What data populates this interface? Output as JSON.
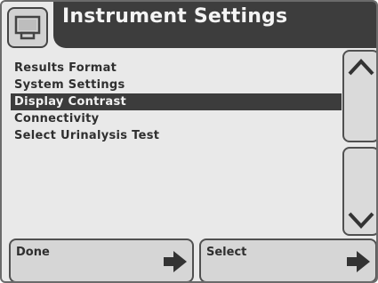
{
  "header": {
    "title": "Instrument Settings",
    "home_icon": "home-icon"
  },
  "menu": {
    "items": [
      {
        "label": "Results Format",
        "selected": false
      },
      {
        "label": "System Settings",
        "selected": false
      },
      {
        "label": "Display Contrast",
        "selected": true
      },
      {
        "label": "Connectivity",
        "selected": false
      },
      {
        "label": "Select Urinalysis Test",
        "selected": false
      }
    ]
  },
  "scroll": {
    "up_icon": "chevron-up-icon",
    "down_icon": "chevron-down-icon"
  },
  "footer": {
    "done_label": "Done",
    "select_label": "Select",
    "arrow_icon": "arrow-right-icon"
  },
  "colors": {
    "header_bg": "#3d3d3d",
    "selected_bg": "#3c3c3c",
    "screen_bg": "#e9e9e9"
  }
}
